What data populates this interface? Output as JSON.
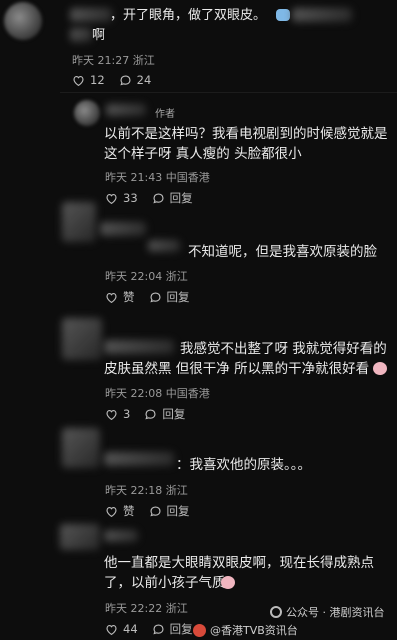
{
  "comments": [
    {
      "text": "，开了眼角，做了双眼皮。",
      "text_tail": "啊",
      "time": "昨天 21:27",
      "location": "浙江",
      "likes": "12",
      "replies": "24"
    },
    {
      "author_tag": "作者",
      "line1": "以前不是这样吗？我看电视剧到的时候感觉就是",
      "line2": "这个样子呀 真人瘦的 头脸都很小",
      "time": "昨天 21:43",
      "location": "中国香港",
      "likes": "33",
      "reply_label": "回复"
    },
    {
      "line1": "不知道呢，但是我喜欢原装的脸",
      "time": "昨天 22:04",
      "location": "浙江",
      "like_label": "赞",
      "reply_label": "回复"
    },
    {
      "line1": "我感觉不出整了呀 我就觉得好看的",
      "line2": "皮肤虽然黑 但很干净 所以黑的干净就很好看",
      "time": "昨天 22:08",
      "location": "中国香港",
      "likes": "3",
      "reply_label": "回复"
    },
    {
      "line1": "：我喜欢他的原装。。。",
      "time": "昨天 22:18",
      "location": "浙江",
      "like_label": "赞",
      "reply_label": "回复"
    },
    {
      "line1": "他一直都是大眼睛双眼皮啊，现在长得成熟点",
      "line2": "了，以前小孩子气质",
      "time": "昨天 22:22",
      "location": "浙江",
      "likes": "44",
      "reply_label": "回复"
    }
  ],
  "watermark": {
    "weibo": "@香港TVB资讯台",
    "wechat": "公众号 · 港剧资讯台"
  }
}
